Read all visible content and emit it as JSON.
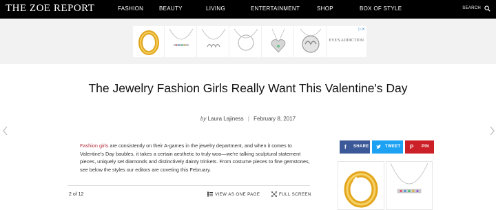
{
  "nav": {
    "logo_prefix": "THE ",
    "logo_main": "ZOE",
    "logo_suffix": " REPORT",
    "items": [
      "FASHION",
      "BEAUTY",
      "LIVING",
      "ENTERTAINMENT",
      "SHOP",
      "BOX OF STYLE"
    ],
    "search_label": "SEARCH"
  },
  "ad": {
    "brand": "EVE'S ADDICTION",
    "adchoices": "▷✕"
  },
  "article": {
    "title": "The Jewelry Fashion Girls Really Want This Valentine's Day",
    "by": "by",
    "author": "Laura Lajiness",
    "date": "February 8, 2017",
    "body_link": "Fashion girls",
    "body_text": " are consistently on their A-games in the jewelry department, and when it comes to Valentine's Day baubles, it takes a certain aesthetic to truly woo—we're talking sculptural statement pieces, uniquely set diamonds and distinctively dainty trinkets. From costume pieces to fine gemstones, see below the styles our editors are coveting this February."
  },
  "gallery": {
    "counter": "2 of 12",
    "view_one_page": "VIEW AS ONE PAGE",
    "full_screen": "FULL SCREEN"
  },
  "share": {
    "facebook": "SHARE",
    "twitter": "TWEET",
    "pinterest": "PIN",
    "colors": {
      "facebook": "#3b5998",
      "twitter": "#1da1f2",
      "pinterest": "#cb2027"
    }
  }
}
